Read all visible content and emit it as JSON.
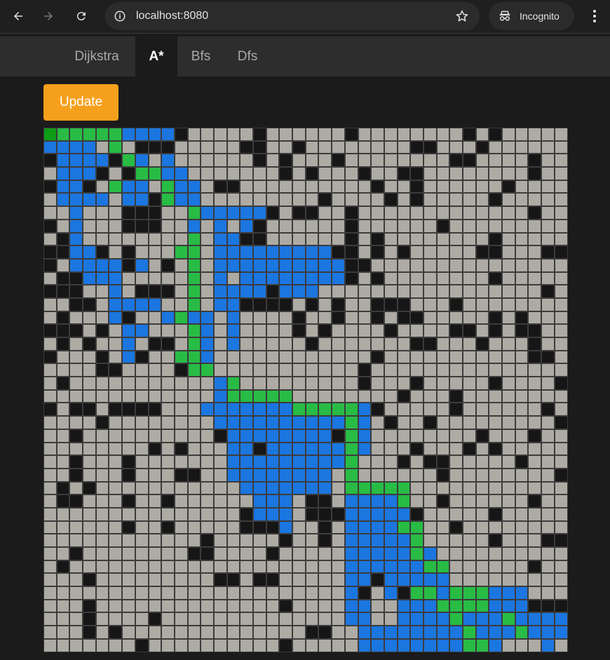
{
  "browser": {
    "url": "localhost:8080",
    "incognito_label": "Incognito",
    "icons": [
      "back-arrow-icon",
      "forward-arrow-icon",
      "reload-icon",
      "site-info-icon",
      "bookmark-star-icon",
      "incognito-icon",
      "more-vert-icon"
    ]
  },
  "tabs": [
    {
      "label": "Dijkstra",
      "active": false
    },
    {
      "label": "A*",
      "active": true
    },
    {
      "label": "Bfs",
      "active": false
    },
    {
      "label": "Dfs",
      "active": false
    }
  ],
  "toolbar": {
    "update_label": "Update"
  },
  "colors": {
    "empty": "#aeaba4",
    "wall": "#161616",
    "visited": "#1b76e0",
    "path": "#28bc45",
    "start": "#0e9c17",
    "end": "#a91b0d",
    "accent": "#f5a01c"
  },
  "grid": {
    "rows": 40,
    "cols": 40,
    "legend": "0=empty,1=wall,2=visited,3=path,4=start,5=end",
    "cells": [
      "4333332222100000100000010000000010100000",
      "2222030111000001100100000000110001000000",
      "1222213202000000101000100000000110000100",
      "0222101332200000001010001001100000000100",
      "1221032203220110000000000100100000010000",
      "0222202213220000000001000010100000100000",
      "0020001110032222210110010000000000000100",
      "1020001110020202100000010000001000000000",
      "0120000000030221100000010100000000100000",
      "1122101000330222222222110101000001100011",
      "1022221201030222222222211000000000000000",
      "0112220000030202222222210100000000100000",
      "1110020111030222212220000000000000000010",
      "0011022220030221111010100111000100000000",
      "0100021002322020000100100101100000101000",
      "1110102200032020000101000010000110101100",
      "0101002011032020000010000000110001000100",
      "1000102100332000000000000100000000000110",
      "0000110000133000000000001000000000000000",
      "0100000000000230000000001000100000100001",
      "0000000000000233333000000001000100000000",
      "1011011110002222222333332100000100000010",
      "0000100000000222222222232010010000000001",
      "0010000000000122222222132000000001000100",
      "0000000010100022122222232000100010100000",
      "0010001000000022222222230001011000001000",
      "0010001000110022222222030000001000000001",
      "0101000000000002222222033333000000000000",
      "0110001001000000222011022223001000000100",
      "0000000000000001222011122222100000100000",
      "0000001001000001112001022223300100000000",
      "0000000000001000001001022222300000100011",
      "0010000000011000010000022222320000000000",
      "0100000000000000000000022222233000000100",
      "0001000000000110110000022122222000000000",
      "0000000000000000000000021021332333222000",
      "0001000000000000001000022002223333222111",
      "0001000010000000000000022002222322232222",
      "0001010000000000000011002222222232223222",
      "0000000100000000001000002222222233200020"
    ]
  }
}
